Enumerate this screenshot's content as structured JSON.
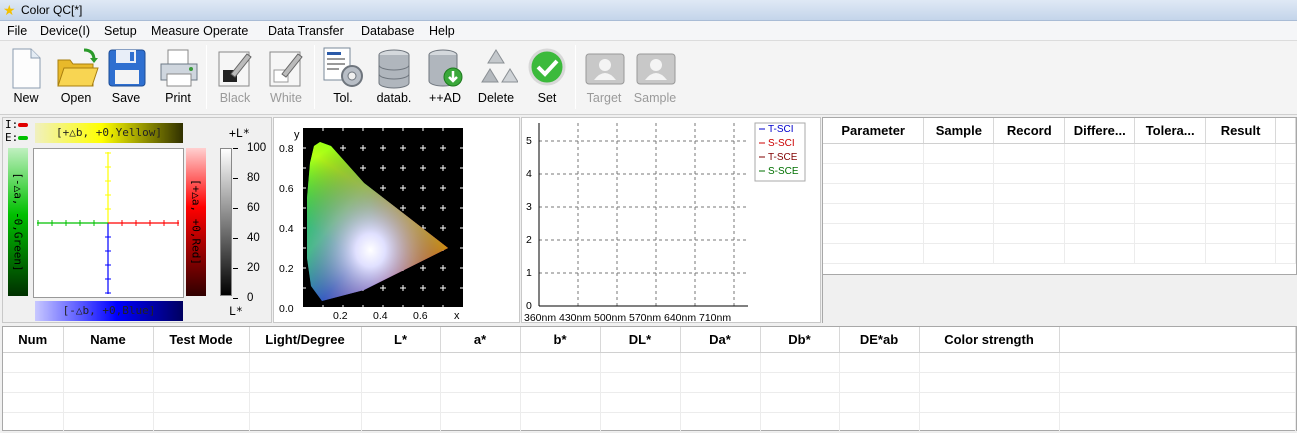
{
  "window": {
    "title": "Color QC[*]"
  },
  "menu": [
    "File",
    "Device(I)",
    "Setup",
    "Measure Operate",
    "Data Transfer",
    "Database",
    "Help"
  ],
  "toolbar": {
    "new": "New",
    "open": "Open",
    "save": "Save",
    "print": "Print",
    "black": "Black",
    "white": "White",
    "tol": "Tol.",
    "datab": "datab.",
    "add": "++AD",
    "delete": "Delete",
    "set": "Set",
    "target": "Target",
    "sample": "Sample"
  },
  "ab_chart": {
    "i_label": "I:",
    "e_label": "E:",
    "top_label": "[+△b, +0,Yellow]",
    "bottom_label": "[-△b, +0,Blue]",
    "left_label": "[-△a, -0,Green]",
    "right_label": "[+△a, +0,Red]",
    "l_top": "+L*",
    "l_bottom": "L*",
    "l_ticks": [
      "100",
      "80",
      "60",
      "40",
      "20",
      "0"
    ],
    "colors": {
      "yellow": "#ffff00",
      "blue": "#0000ff",
      "green": "#00c000",
      "red": "#ff0000"
    }
  },
  "cie_chart": {
    "y_label": "y",
    "x_label": "x",
    "y_ticks": [
      "0.8",
      "0.6",
      "0.4",
      "0.2",
      "0.0"
    ],
    "x_ticks": [
      "0.2",
      "0.4",
      "0.6"
    ]
  },
  "spectrum_chart": {
    "y_ticks": [
      "5",
      "4",
      "3",
      "2",
      "1",
      "0"
    ],
    "x_ticks": [
      "360nm",
      "430nm",
      "500nm",
      "570nm",
      "640nm",
      "710nm"
    ],
    "legend": [
      {
        "name": "T-SCI",
        "color": "#0000cc"
      },
      {
        "name": "S-SCI",
        "color": "#cc0000"
      },
      {
        "name": "T-SCE",
        "color": "#800000"
      },
      {
        "name": "S-SCE",
        "color": "#007000"
      }
    ]
  },
  "param_table": {
    "headers": [
      "Parameter",
      "Sample",
      "Record",
      "Differe...",
      "Tolera...",
      "Result"
    ]
  },
  "data_table": {
    "headers": [
      "Num",
      "Name",
      "Test Mode",
      "Light/Degree",
      "L*",
      "a*",
      "b*",
      "DL*",
      "Da*",
      "Db*",
      "DE*ab",
      "Color strength"
    ]
  }
}
